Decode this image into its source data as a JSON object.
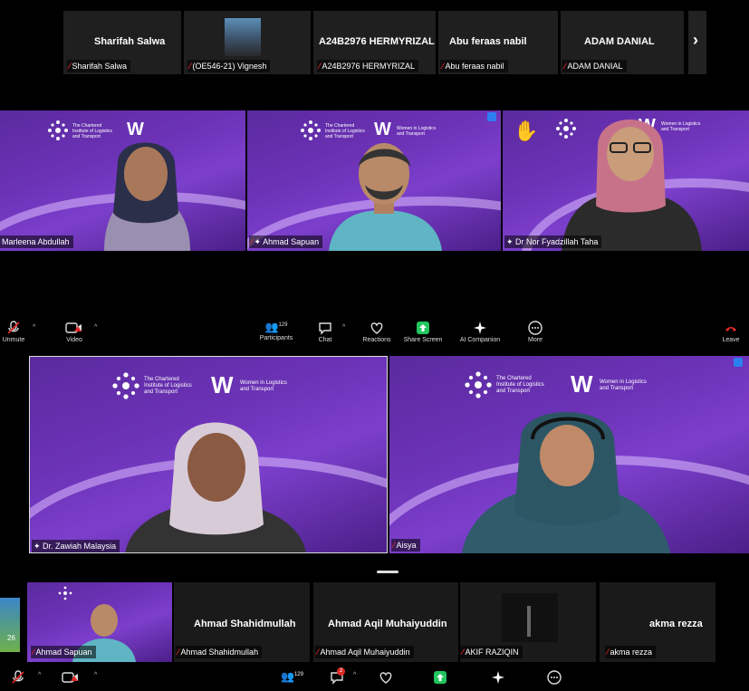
{
  "top_strip": {
    "tiles": [
      {
        "display_name": "Sharifah Salwa",
        "label": "Sharifah Salwa"
      },
      {
        "display_name": "",
        "label": "(OE546-21) Vignesh"
      },
      {
        "display_name": "A24B2976 HERMYRIZAL",
        "label": "A24B2976 HERMYRIZAL"
      },
      {
        "display_name": "Abu feraas nabil",
        "label": "Abu feraas nabil"
      },
      {
        "display_name": "ADAM DANIAL",
        "label": "ADAM DANIAL"
      }
    ],
    "next_arrow": "›"
  },
  "video_row": {
    "tiles": [
      {
        "label": "Marleena Abdullah"
      },
      {
        "label": "Ahmad Sapuan"
      },
      {
        "label": "Dr Nor Fyadzillah Taha"
      }
    ]
  },
  "branding": {
    "org_line1": "The Chartered",
    "org_line2": "Institute of Logistics",
    "org_line3": "and Transport",
    "wilat_line1": "Women in Logistics",
    "wilat_line2": "and Transport"
  },
  "toolbar1": {
    "unmute": "Unmute",
    "video": "Video",
    "participants": "Participants",
    "participants_count": "129",
    "chat": "Chat",
    "reactions": "Reactions",
    "share_screen": "Share Screen",
    "ai_companion": "AI Companion",
    "more": "More",
    "leave": "Leave"
  },
  "speaker_row": {
    "tiles": [
      {
        "label": "Dr. Zawiah Malaysia"
      },
      {
        "label": "Aisya"
      }
    ]
  },
  "bottom_strip": {
    "side_number": "26",
    "tiles": [
      {
        "display_name": "",
        "label": "Ahmad Sapuan"
      },
      {
        "display_name": "Ahmad Shahidmullah",
        "label": "Ahmad Shahidmullah"
      },
      {
        "display_name": "Ahmad Aqil Muhaiyuddin",
        "label": "Ahmad Aqil Muhaiyuddin"
      },
      {
        "display_name": "",
        "label": "AKIF RAZIQIN"
      },
      {
        "display_name": "akma rezza",
        "label": "akma rezza"
      }
    ]
  },
  "toolbar2": {
    "participants_count": "129",
    "chat_badge": "2"
  },
  "colors": {
    "accent_blue": "#2d7ff0",
    "mic_off_red": "#e02828",
    "share_green": "#22c55e",
    "brand_purple": "#6d33b8"
  }
}
